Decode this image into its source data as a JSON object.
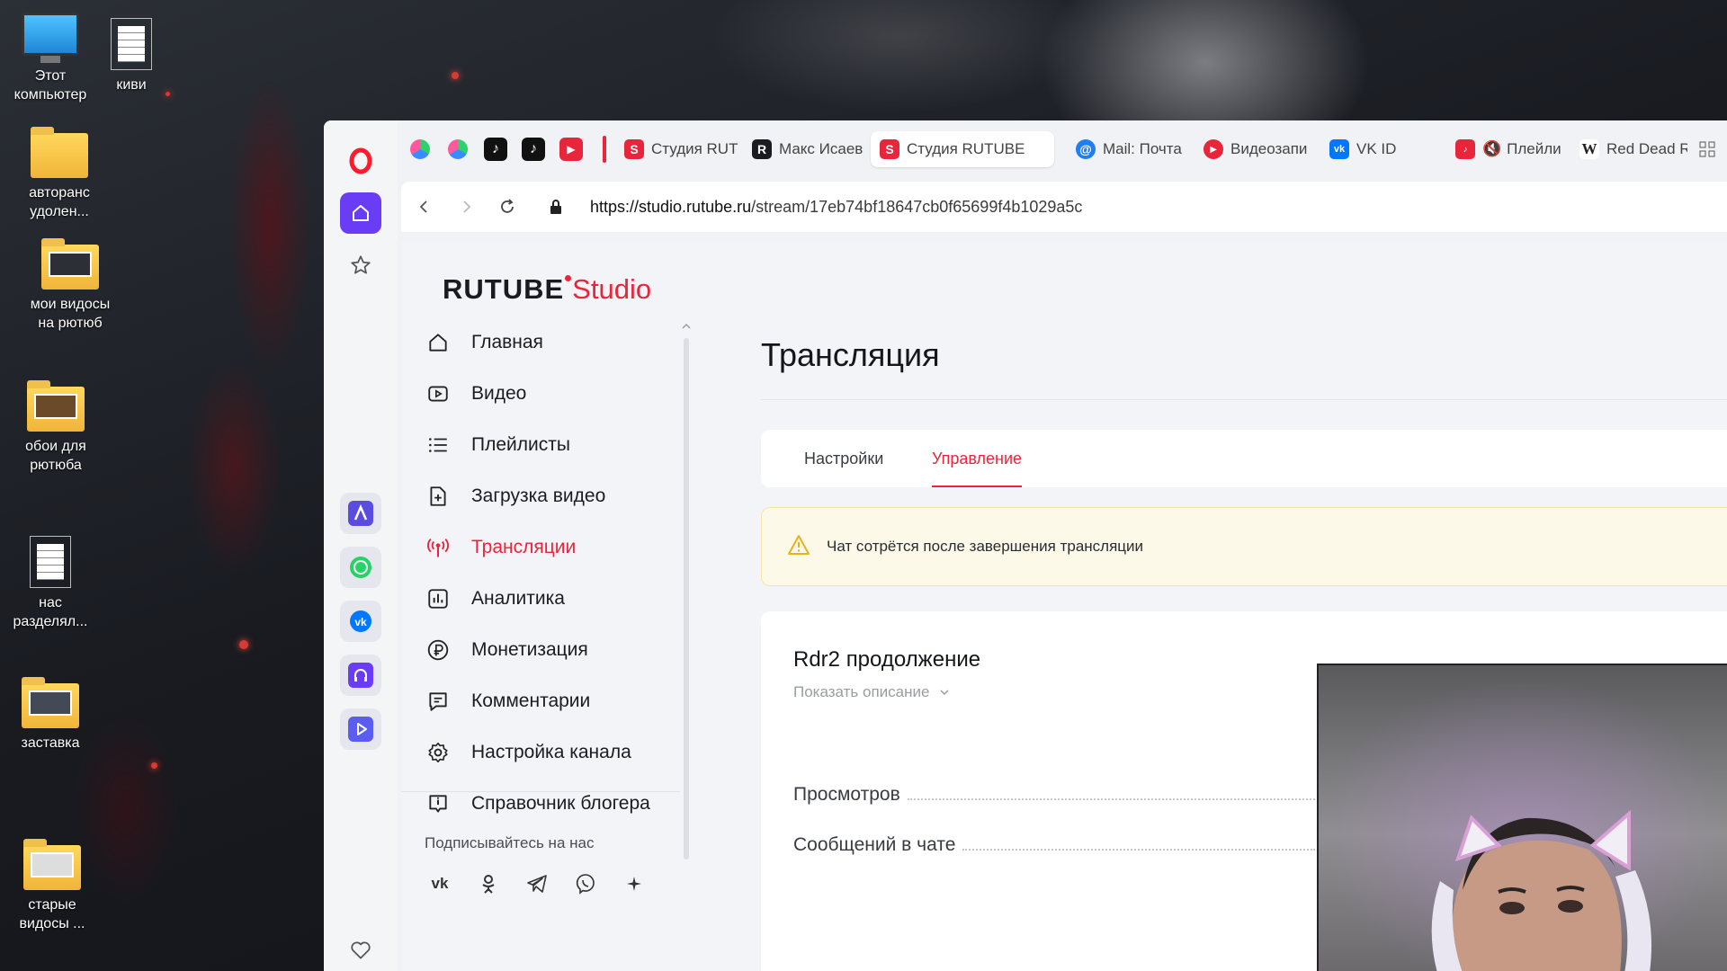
{
  "desktop": {
    "icons": [
      {
        "label": "Этот компьютер"
      },
      {
        "label": "киви"
      },
      {
        "label": "авторанс удолен..."
      },
      {
        "label": "мои видосы на рютюб"
      },
      {
        "label": "обои для рютюба"
      },
      {
        "label": "нас разделял..."
      },
      {
        "label": "заставка"
      },
      {
        "label": "старые видосы ..."
      }
    ]
  },
  "browser": {
    "tabs": [
      {
        "label": "Студия RUT",
        "favicon": "rutube-studio-icon",
        "color": "#e8253b"
      },
      {
        "label": "Макс Исаев",
        "favicon": "rutube-icon",
        "color": "#1b1c22"
      },
      {
        "label": "Студия RUTUBE",
        "favicon": "rutube-studio-icon",
        "color": "#e8253b",
        "active": true
      },
      {
        "label": "Mail: Почта",
        "favicon": "mail-icon",
        "color": "#1f7ef0"
      },
      {
        "label": "Видеозапи",
        "favicon": "video-icon",
        "color": "#e8253b"
      },
      {
        "label": "VK ID",
        "favicon": "vk-icon",
        "color": "#0077ff"
      },
      {
        "label": "Плейли",
        "favicon": "music-icon",
        "color": "#e8253b"
      },
      {
        "label": "Red Dead R",
        "favicon": "wikipedia-icon",
        "color": "#ffffff"
      }
    ],
    "url_host": "https://studio.rutube.ru",
    "url_path": "/stream/17eb74bf18647cb0f65699f4b1029a5c"
  },
  "studio": {
    "logo_main": "RUTUBE",
    "logo_studio": "Studio",
    "nav": [
      {
        "label": "Главная",
        "icon": "home-icon"
      },
      {
        "label": "Видео",
        "icon": "video-icon"
      },
      {
        "label": "Плейлисты",
        "icon": "list-icon"
      },
      {
        "label": "Загрузка видео",
        "icon": "upload-file-icon"
      },
      {
        "label": "Трансляции",
        "icon": "broadcast-icon",
        "active": true
      },
      {
        "label": "Аналитика",
        "icon": "analytics-icon"
      },
      {
        "label": "Монетизация",
        "icon": "ruble-icon"
      },
      {
        "label": "Комментарии",
        "icon": "comment-icon"
      },
      {
        "label": "Настройка канала",
        "icon": "gear-icon"
      },
      {
        "label": "Справочник блогера",
        "icon": "info-icon"
      }
    ],
    "subscribe_label": "Подписывайтесь на нас",
    "page_title": "Трансляция",
    "tabs": [
      {
        "label": "Настройки"
      },
      {
        "label": "Управление",
        "active": true
      }
    ],
    "warning": "Чат сотрётся после завершения трансляции",
    "stream_title": "Rdr2 продолжение",
    "show_description": "Показать описание",
    "stats": [
      {
        "label": "Просмотров"
      },
      {
        "label": "Сообщений в чате"
      }
    ]
  },
  "colors": {
    "accent": "#e8253b",
    "opera_purple": "#6b3cf5",
    "warning_bg": "#fdf9e8"
  }
}
